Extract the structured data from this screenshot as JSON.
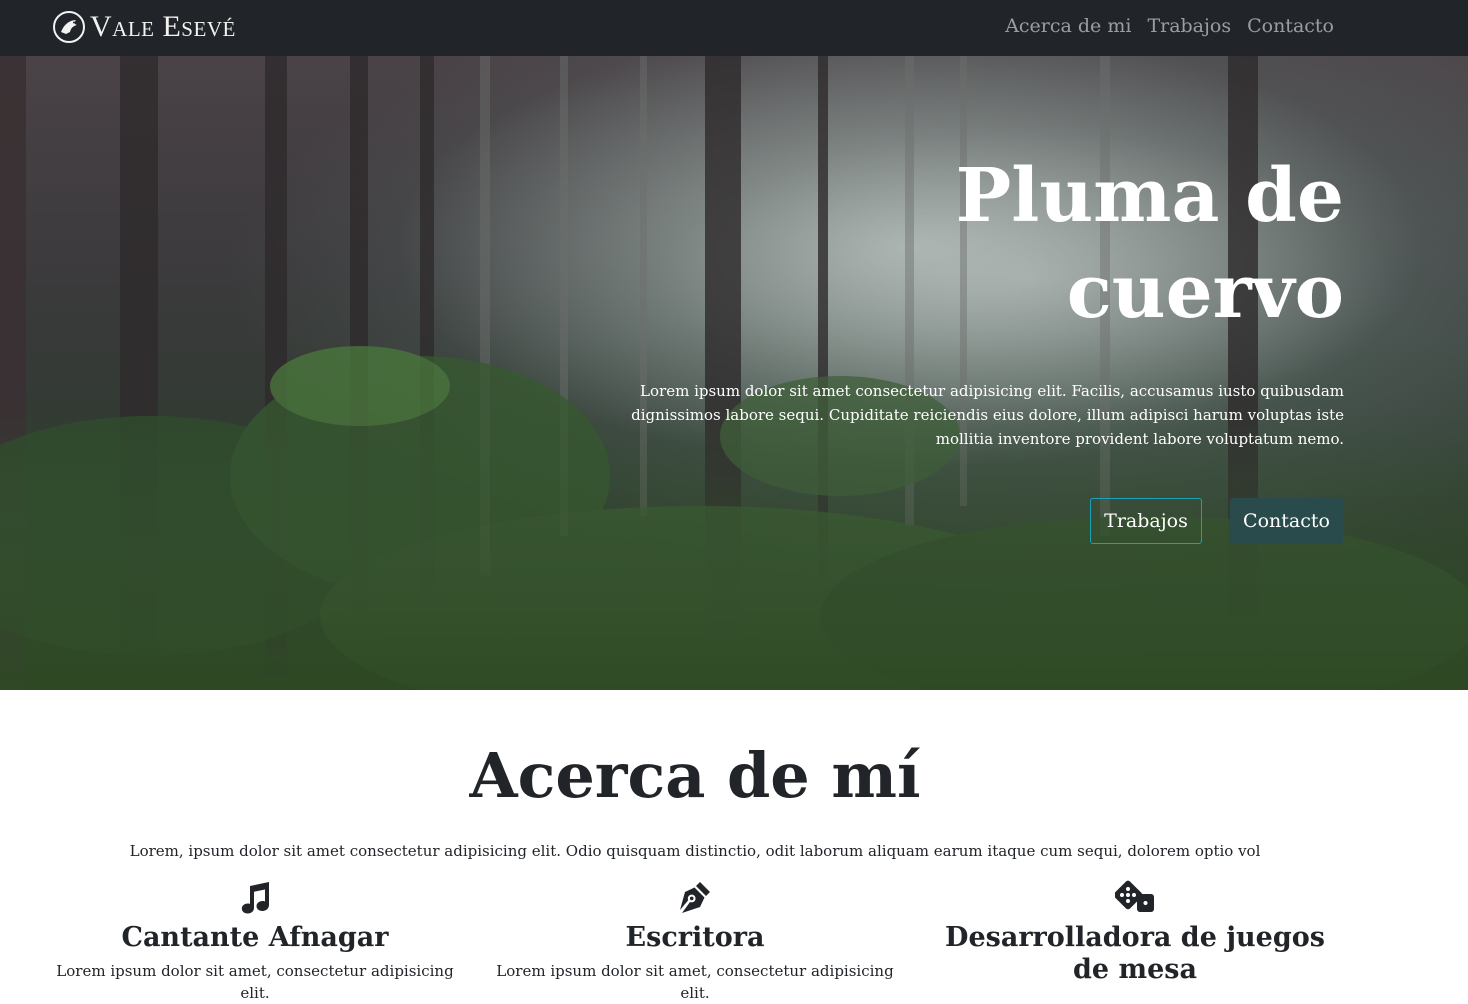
{
  "navbar": {
    "brand": "Vale Esevé",
    "links": [
      "Acerca de mi",
      "Trabajos",
      "Contacto"
    ]
  },
  "hero": {
    "title": "Pluma de cuervo",
    "text": "Lorem ipsum dolor sit amet consectetur adipisicing elit. Facilis, accusamus iusto quibusdam dignissimos labore sequi. Cupiditate reiciendis eius dolore, illum adipisci harum voluptas iste mollitia inventore provident labore voluptatum nemo.",
    "buttons": {
      "outline": "Trabajos",
      "solid": "Contacto"
    }
  },
  "about": {
    "title": "Acerca de mí",
    "text": "Lorem, ipsum dolor sit amet consectetur adipisicing elit. Odio quisquam distinctio, odit laborum aliquam earum itaque cum sequi, dolorem optio vol",
    "features": [
      {
        "icon": "music-icon",
        "title": "Cantante Afnagar",
        "text": "Lorem ipsum dolor sit amet, consectetur adipisicing elit."
      },
      {
        "icon": "pen-nib-icon",
        "title": "Escritora",
        "text": "Lorem ipsum dolor sit amet, consectetur adipisicing elit."
      },
      {
        "icon": "dice-icon",
        "title": "Desarrolladora de juegos de mesa",
        "text": ""
      }
    ]
  },
  "colors": {
    "navbar": "#212529",
    "accent_outline": "#17a2b8",
    "button_solid": "#2a4b4b"
  }
}
